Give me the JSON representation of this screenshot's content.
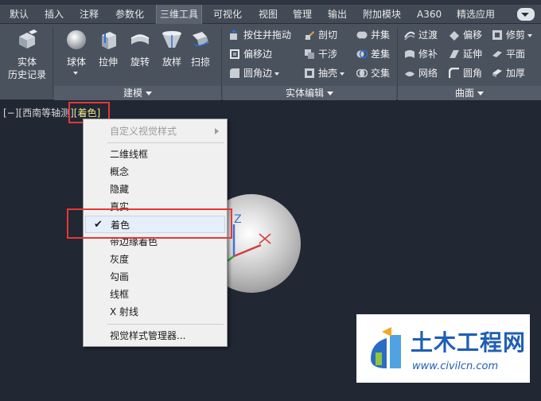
{
  "ribbon_tabs": [
    "默认",
    "插入",
    "注释",
    "参数化",
    "三维工具",
    "可视化",
    "视图",
    "管理",
    "输出",
    "附加模块",
    "A360",
    "精选应用"
  ],
  "active_tab": "三维工具",
  "modeling_panel": {
    "label": "建模",
    "big_buttons": [
      "实体\n历史记录",
      "球体",
      "拉伸",
      "旋转",
      "放样",
      "扫掠"
    ]
  },
  "solid_edit_panel": {
    "label": "实体编辑",
    "col1": [
      "按住并拖动",
      "偏移边",
      "圆角边"
    ],
    "col2": [
      "剖切",
      "干涉",
      "抽壳"
    ],
    "col3": [
      "并集",
      "差集",
      "交集"
    ]
  },
  "surface_panel": {
    "label": "曲面",
    "col1": [
      "过渡",
      "修补",
      "网络"
    ],
    "col2": [
      "偏移",
      "延伸",
      "圆角"
    ],
    "col3": [
      "修剪",
      "平面",
      "加厚"
    ]
  },
  "viewport": {
    "label_prefix": "[−][西南等轴测]",
    "style_label": "[着色]"
  },
  "context_menu": {
    "header": "自定义视觉样式",
    "items": [
      "二维线框",
      "概念",
      "隐藏",
      "真实",
      "着色",
      "带边缘着色",
      "灰度",
      "勾画",
      "线框",
      "X 射线"
    ],
    "checked_item": "着色",
    "footer": "视觉样式管理器..."
  },
  "axis_labels": {
    "z": "Z"
  },
  "logo": {
    "name": "土木工程网",
    "url": "www.civilcn.com"
  },
  "colors": {
    "highlight_red": "#e53935",
    "style_label_yellow": "#f0e68c",
    "logo_blue": "#1f5fb4"
  }
}
